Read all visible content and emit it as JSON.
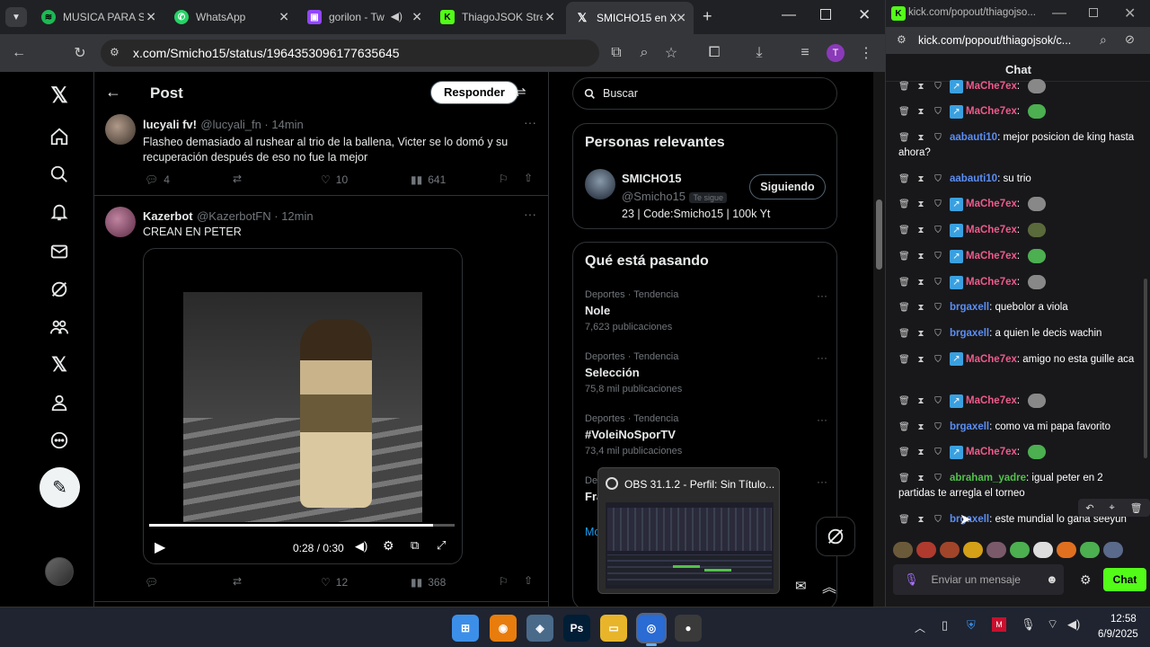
{
  "browser": {
    "tabs": [
      {
        "label": "MUSICA PARA S",
        "icon": "spotify-icon",
        "color": "#1db954"
      },
      {
        "label": "WhatsApp",
        "icon": "whatsapp-icon",
        "color": "#25d366"
      },
      {
        "label": "gorilon - Tw",
        "icon": "twitch-icon",
        "color": "#9146ff"
      },
      {
        "label": "ThiagoJSOK Stre",
        "icon": "kick-icon",
        "color": "#53fc18"
      },
      {
        "label": "SMICHO15 en X",
        "icon": "x-icon",
        "color": "#ffffff"
      }
    ],
    "url": "x.com/Smicho15/status/1964353096177635645",
    "profile_initial": "T"
  },
  "x": {
    "header_title": "Post",
    "reply_button": "Responder",
    "search_placeholder": "Buscar",
    "tweets": [
      {
        "name": "lucyali fv!",
        "meta": "@lucyali_fn · 14min",
        "text": "Flasheo demasiado al rushear al trio de la ballena, Victer se lo domó y su recuperación después de eso no fue la mejor",
        "replies": "4",
        "likes": "10",
        "views": "641"
      },
      {
        "name": "Kazerbot",
        "meta": "@KazerbotFN · 12min",
        "text": "CREAN EN PETER",
        "video_time": "0:28 / 0:30",
        "video_progress": 0.93,
        "replies": "",
        "likes": "12",
        "views": "368"
      }
    ],
    "relevant": {
      "title": "Personas relevantes",
      "name": "SMICHO15",
      "handle": "@Smicho15",
      "follows_you": "Te sigue",
      "bio": "23 | Code:Smicho15 | 100k Yt",
      "follow_button": "Siguiendo"
    },
    "trends": {
      "title": "Qué está pasando",
      "items": [
        {
          "category": "Deportes · Tendencia",
          "name": "Nole",
          "count": "7,623 publicaciones"
        },
        {
          "category": "Deportes · Tendencia",
          "name": "Selección",
          "count": "75,8 mil publicaciones"
        },
        {
          "category": "Deportes · Tendencia",
          "name": "#VoleiNoSporTV",
          "count": "73,4 mil publicaciones"
        },
        {
          "category": "De",
          "name": "Fra",
          "count": ""
        }
      ],
      "more": "Mo"
    },
    "obs_tooltip": "OBS 31.1.2 - Perfil: Sin Título..."
  },
  "kick": {
    "title_url": "kick.com/popout/thiagojso...",
    "toolbar_url": "kick.com/popout/thiagojsok/c...",
    "header": "Chat",
    "messages": [
      {
        "user": "MaChe7ex",
        "color": "#f05a8a",
        "badge": true,
        "text": "",
        "emote": "#888888"
      },
      {
        "user": "MaChe7ex",
        "color": "#f05a8a",
        "badge": true,
        "text": "",
        "emote": "#4caf50"
      },
      {
        "user": "aabauti10",
        "color": "#5b8ef5",
        "badge": false,
        "text": "mejor posicion de king hasta ahora?",
        "emote": ""
      },
      {
        "user": "aabauti10",
        "color": "#5b8ef5",
        "badge": false,
        "text": "su trio",
        "emote": ""
      },
      {
        "user": "MaChe7ex",
        "color": "#f05a8a",
        "badge": true,
        "text": "",
        "emote": "#888888"
      },
      {
        "user": "MaChe7ex",
        "color": "#f05a8a",
        "badge": true,
        "text": "",
        "emote": "#5a6a3a"
      },
      {
        "user": "MaChe7ex",
        "color": "#f05a8a",
        "badge": true,
        "text": "",
        "emote": "#4caf50"
      },
      {
        "user": "MaChe7ex",
        "color": "#f05a8a",
        "badge": true,
        "text": "",
        "emote": "#888888"
      },
      {
        "user": "brgaxell",
        "color": "#5b8ef5",
        "badge": false,
        "text": "quebolor a viola",
        "emote": ""
      },
      {
        "user": "brgaxell",
        "color": "#5b8ef5",
        "badge": false,
        "text": "a quien le decis wachin",
        "emote": ""
      },
      {
        "user": "MaChe7ex",
        "color": "#f05a8a",
        "badge": true,
        "text": "amigo no esta guille aca",
        "emote": ""
      },
      {
        "user": "MaChe7ex",
        "color": "#f05a8a",
        "badge": true,
        "text": "",
        "emote": "#888888"
      },
      {
        "user": "brgaxell",
        "color": "#5b8ef5",
        "badge": false,
        "text": "como va mi papa favorito",
        "emote": ""
      },
      {
        "user": "MaChe7ex",
        "color": "#f05a8a",
        "badge": true,
        "text": "",
        "emote": "#4caf50"
      },
      {
        "user": "abraham_yadre",
        "color": "#53c14b",
        "badge": false,
        "text": "igual peter en 2 partidas te arregla el torneo",
        "emote": ""
      },
      {
        "user": "brgaxell",
        "color": "#5b8ef5",
        "badge": false,
        "text": "este mundial lo gana seeyun",
        "emote": ""
      }
    ],
    "emote_bar": [
      "#6b5a3a",
      "#b03a2e",
      "#a0452a",
      "#d4a017",
      "#7a5a6a",
      "#4caf50",
      "#dddddd",
      "#e07020",
      "#4caf50",
      "#5a6a8a"
    ],
    "input_placeholder": "Enviar un mensaje",
    "send_button": "Chat"
  },
  "taskbar": {
    "apps": [
      {
        "name": "windows-start-icon",
        "label": "⊞",
        "color": "#3c8fe8"
      },
      {
        "name": "blender-icon",
        "label": "◉",
        "color": "#e87d0d"
      },
      {
        "name": "davinci-icon",
        "label": "◈",
        "color": "#4a6a8a"
      },
      {
        "name": "photoshop-icon",
        "label": "Ps",
        "color": "#001e36"
      },
      {
        "name": "file-explorer-icon",
        "label": "▭",
        "color": "#e8b52a"
      },
      {
        "name": "chrome-icon",
        "label": "◎",
        "color": "#2a6bd4"
      },
      {
        "name": "obs-icon",
        "label": "●",
        "color": "#3a3a3a"
      }
    ],
    "time": "12:58",
    "date": "6/9/2025"
  }
}
